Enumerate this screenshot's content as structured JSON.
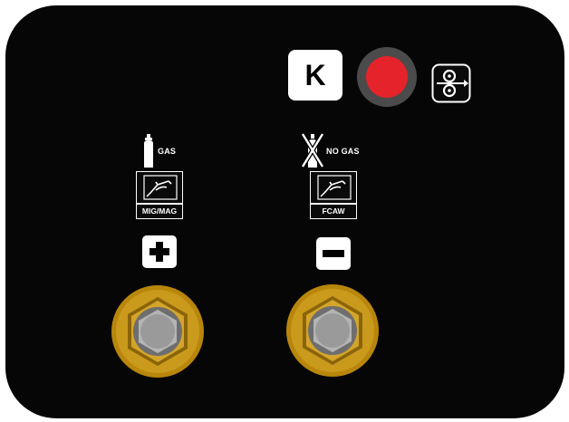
{
  "panel": {
    "background": "#060606"
  },
  "controls": {
    "k_button_label": "K",
    "red_button_color": "#e4232a",
    "wire_feed_icon": "wire-feed-icon"
  },
  "outputs": [
    {
      "gas_label": "GAS",
      "gas_icon": "gas-bottle-icon",
      "torch_icon": "mig-torch-icon",
      "mode_label": "MIG/MAG",
      "polarity": "plus",
      "polarity_icon": "plus-icon"
    },
    {
      "gas_label": "NO GAS",
      "gas_icon": "no-gas-icon",
      "torch_icon": "mig-torch-icon",
      "mode_label": "FCAW",
      "polarity": "minus",
      "polarity_icon": "minus-icon"
    }
  ],
  "colors": {
    "brass": "#b8860b",
    "steel": "#9a9a9a",
    "red": "#e4232a"
  }
}
